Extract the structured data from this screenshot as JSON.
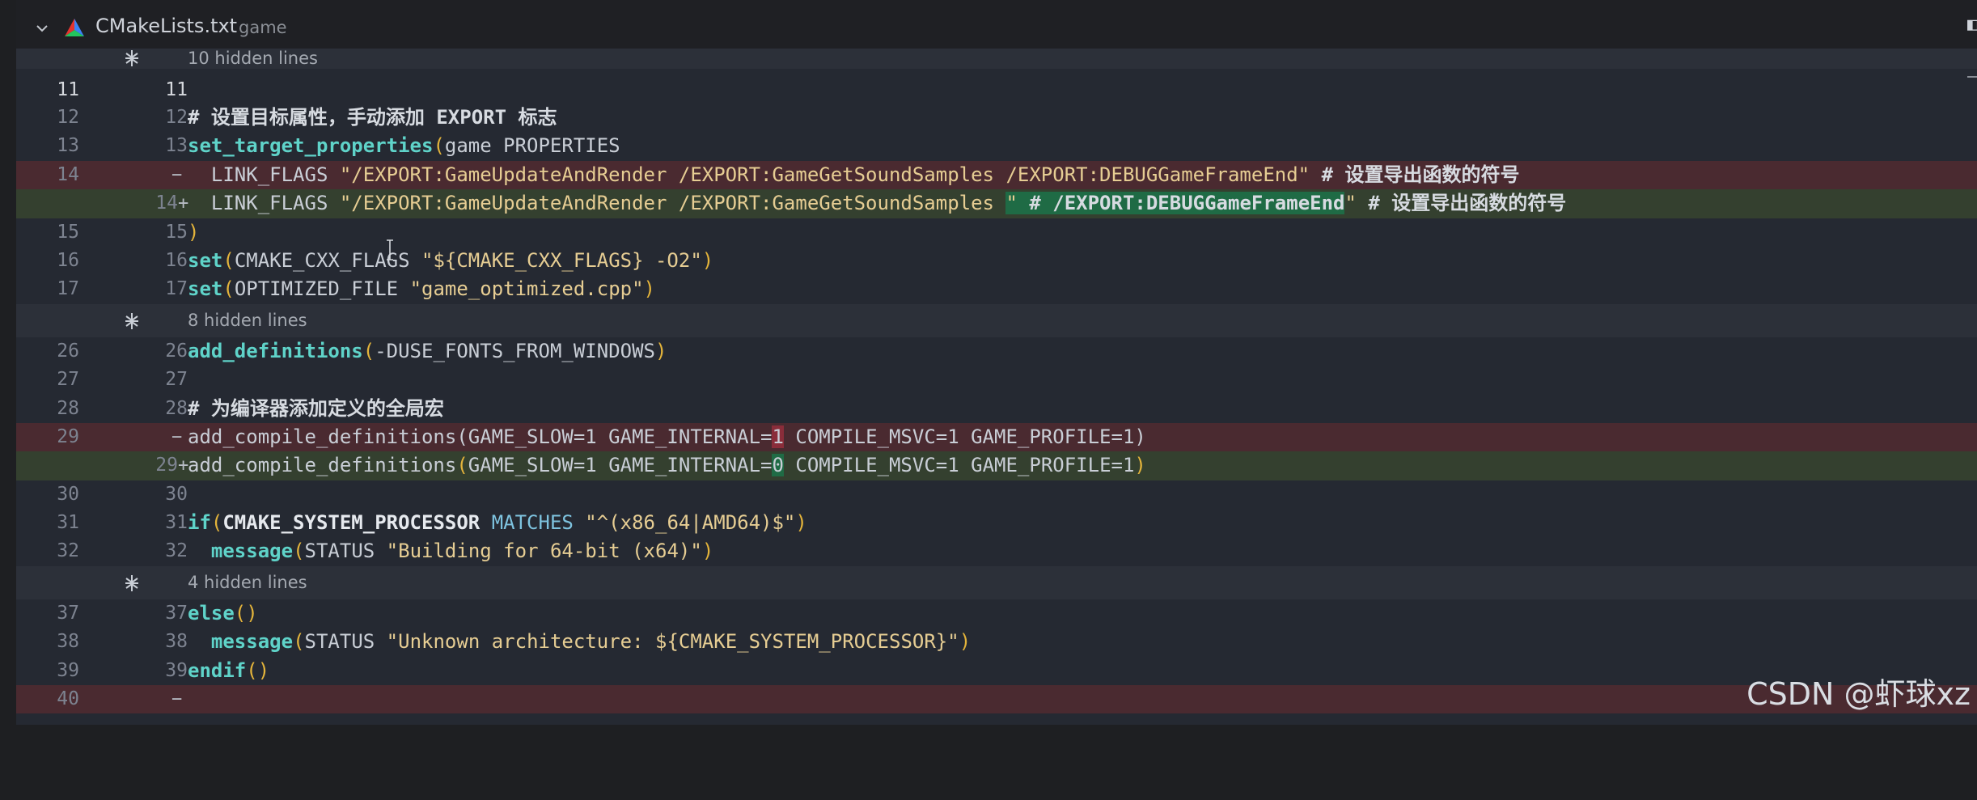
{
  "header": {
    "file_name": "CMakeLists.txt",
    "folder": "game"
  },
  "folds": {
    "f1": "10 hidden lines",
    "f2": "8 hidden lines",
    "f3": "4 hidden lines"
  },
  "lines": {
    "l11": {
      "old": "11",
      "new": "11"
    },
    "l12": {
      "old": "12",
      "new": "12",
      "code": "# 设置目标属性，手动添加 EXPORT 标志"
    },
    "l13": {
      "old": "13",
      "new": "13",
      "fn": "set_target_properties",
      "lp": "(",
      "rest": "game PROPERTIES"
    },
    "l14d": {
      "old": "14",
      "marker": "−",
      "indent": "  LINK_FLAGS ",
      "str": "\"/EXPORT:GameUpdateAndRender /EXPORT:GameGetSoundSamples /EXPORT:DEBUGGameFrameEnd\"",
      "comment": " # 设置导出函数的符号"
    },
    "l14a": {
      "new": "14",
      "marker": "+",
      "indent": "  LINK_FLAGS ",
      "str": "\"/EXPORT:GameUpdateAndRender /EXPORT:GameGetSoundSamples ",
      "str_hl": "\"",
      "mid": " # /EXPORT:DEBUGGameFrameEnd",
      "str2": "\"",
      "comment": " # 设置导出函数的符号"
    },
    "l15": {
      "old": "15",
      "new": "15",
      "code": ")"
    },
    "l16": {
      "old": "16",
      "new": "16",
      "fn": "set",
      "lp": "(",
      "rest": "CMAKE_CXX_FLAGS ",
      "str": "\"${CMAKE_CXX_FLAGS} -O2\"",
      "rp": ")"
    },
    "l17": {
      "old": "17",
      "new": "17",
      "fn": "set",
      "lp": "(",
      "rest": "OPTIMIZED_FILE ",
      "str": "\"game_optimized.cpp\"",
      "rp": ")"
    },
    "l26": {
      "old": "26",
      "new": "26",
      "fn": "add_definitions",
      "lp": "(",
      "rest": "-DUSE_FONTS_FROM_WINDOWS",
      "rp": ")"
    },
    "l27": {
      "old": "27",
      "new": "27"
    },
    "l28": {
      "old": "28",
      "new": "28",
      "code": "# 为编译器添加定义的全局宏"
    },
    "l29d": {
      "old": "29",
      "marker": "−",
      "a": "add_compile_definitions(GAME_SLOW=1 GAME_INTERNAL=",
      "hl": "1",
      "b": " COMPILE_MSVC=1 GAME_PROFILE=1)"
    },
    "l29a": {
      "new": "29",
      "marker": "+",
      "a": "add_compile_definitions",
      "lp": "(",
      "mid": "GAME_SLOW=1 GAME_INTERNAL=",
      "hl": "0",
      "b": " COMPILE_MSVC=1 GAME_PROFILE=1",
      "rp": ")"
    },
    "l30": {
      "old": "30",
      "new": "30"
    },
    "l31": {
      "old": "31",
      "new": "31",
      "kw": "if",
      "lp": "(",
      "var": "CMAKE_SYSTEM_PROCESSOR",
      "kw2": " MATCHES ",
      "str": "\"^(x86_64|AMD64)$\"",
      "rp": ")"
    },
    "l32": {
      "old": "32",
      "new": "32",
      "indent": "  ",
      "fn": "message",
      "lp": "(",
      "rest": "STATUS ",
      "str": "\"Building for 64-bit (x64)\"",
      "rp": ")"
    },
    "l37": {
      "old": "37",
      "new": "37",
      "kw": "else",
      "paren": "()"
    },
    "l38": {
      "old": "38",
      "new": "38",
      "indent": "  ",
      "fn": "message",
      "lp": "(",
      "rest": "STATUS ",
      "str": "\"Unknown architecture: ${CMAKE_SYSTEM_PROCESSOR}\"",
      "rp": ")"
    },
    "l39": {
      "old": "39",
      "new": "39",
      "kw": "endif",
      "paren": "()"
    },
    "l40": {
      "old": "40",
      "marker": "−"
    }
  },
  "watermark": "CSDN @虾球xz",
  "colors": {
    "deleted_line": "#4a2a30",
    "added_line": "#34402f",
    "function": "#5fd3c9",
    "string": "#e6cd93",
    "paren": "#e4b43b"
  },
  "icons": [
    "chevron-down-icon",
    "cmake-icon",
    "unfold-icon",
    "text-cursor-icon"
  ]
}
